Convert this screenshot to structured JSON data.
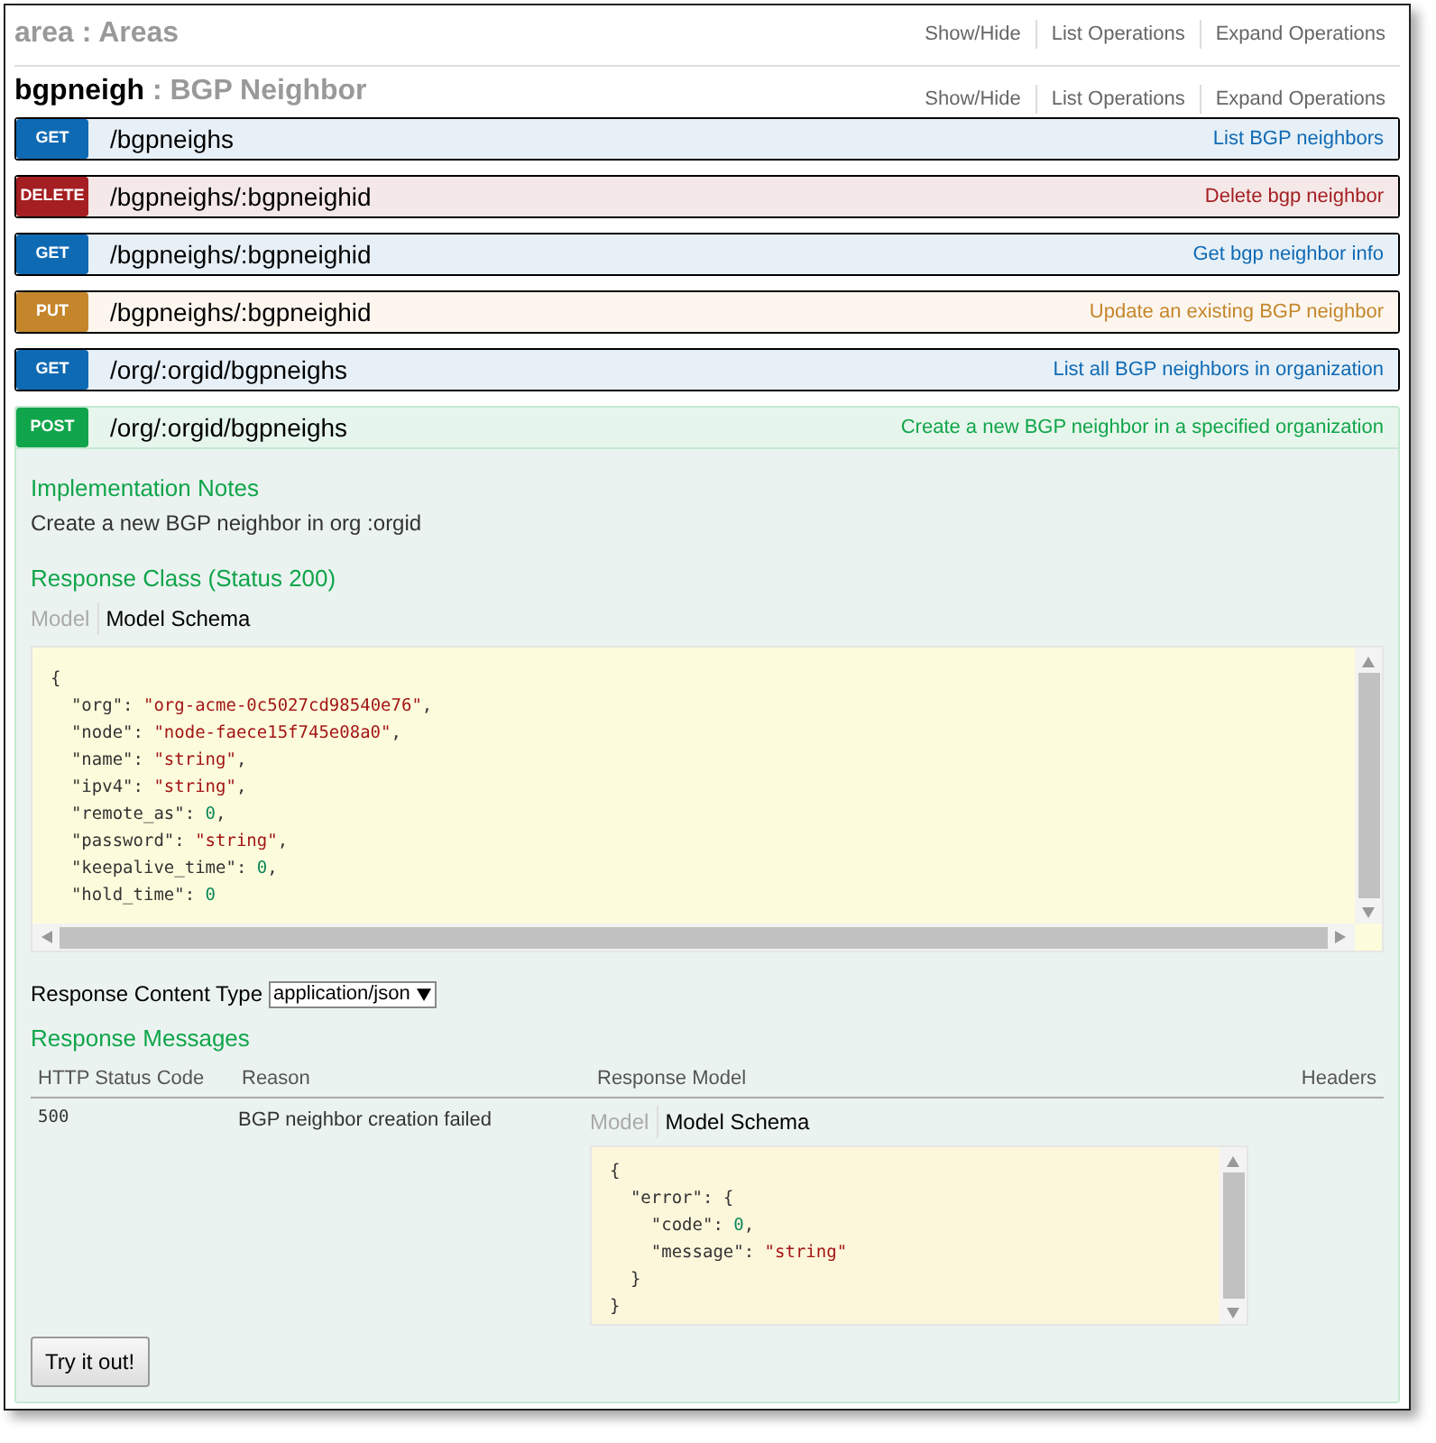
{
  "area": {
    "name": "area",
    "separator": ":",
    "title": "Areas",
    "links": [
      "Show/Hide",
      "List Operations",
      "Expand Operations"
    ]
  },
  "resource": {
    "name": "bgpneigh",
    "separator": ":",
    "title": "BGP Neighbor",
    "links": [
      "Show/Hide",
      "List Operations",
      "Expand Operations"
    ]
  },
  "operations": [
    {
      "method": "GET",
      "path": "/bgpneighs",
      "summary": "List BGP neighbors",
      "expanded": false
    },
    {
      "method": "DELETE",
      "path": "/bgpneighs/:bgpneighid",
      "summary": "Delete bgp neighbor",
      "expanded": false
    },
    {
      "method": "GET",
      "path": "/bgpneighs/:bgpneighid",
      "summary": "Get bgp neighbor info",
      "expanded": false
    },
    {
      "method": "PUT",
      "path": "/bgpneighs/:bgpneighid",
      "summary": "Update an existing BGP neighbor",
      "expanded": false
    },
    {
      "method": "GET",
      "path": "/org/:orgid/bgpneighs",
      "summary": "List all BGP neighbors in organization",
      "expanded": false
    },
    {
      "method": "POST",
      "path": "/org/:orgid/bgpneighs",
      "summary": "Create a new BGP neighbor in a specified organization",
      "expanded": true
    }
  ],
  "details": {
    "notes_heading": "Implementation Notes",
    "notes": "Create a new BGP neighbor in org :orgid",
    "response_class_heading": "Response Class (Status 200)",
    "model_tabs": [
      {
        "label": "Model",
        "selected": false
      },
      {
        "label": "Model Schema",
        "selected": true
      }
    ],
    "schema": [
      [
        {
          "t": "{",
          "kind": "plain"
        }
      ],
      [
        {
          "t": "  \"org\": ",
          "kind": "plain"
        },
        {
          "t": "\"org-acme-0c5027cd98540e76\"",
          "kind": "string"
        },
        {
          "t": ",",
          "kind": "plain"
        }
      ],
      [
        {
          "t": "  \"node\": ",
          "kind": "plain"
        },
        {
          "t": "\"node-faece15f745e08a0\"",
          "kind": "string"
        },
        {
          "t": ",",
          "kind": "plain"
        }
      ],
      [
        {
          "t": "  \"name\": ",
          "kind": "plain"
        },
        {
          "t": "\"string\"",
          "kind": "string"
        },
        {
          "t": ",",
          "kind": "plain"
        }
      ],
      [
        {
          "t": "  \"ipv4\": ",
          "kind": "plain"
        },
        {
          "t": "\"string\"",
          "kind": "string"
        },
        {
          "t": ",",
          "kind": "plain"
        }
      ],
      [
        {
          "t": "  \"remote_as\": ",
          "kind": "plain"
        },
        {
          "t": "0",
          "kind": "number"
        },
        {
          "t": ",",
          "kind": "plain"
        }
      ],
      [
        {
          "t": "  \"password\": ",
          "kind": "plain"
        },
        {
          "t": "\"string\"",
          "kind": "string"
        },
        {
          "t": ",",
          "kind": "plain"
        }
      ],
      [
        {
          "t": "  \"keepalive_time\": ",
          "kind": "plain"
        },
        {
          "t": "0",
          "kind": "number"
        },
        {
          "t": ",",
          "kind": "plain"
        }
      ],
      [
        {
          "t": "  \"hold_time\": ",
          "kind": "plain"
        },
        {
          "t": "0",
          "kind": "number"
        }
      ]
    ],
    "content_type_label": "Response Content Type",
    "content_type": "application/json",
    "messages_heading": "Response Messages",
    "columns": [
      "HTTP Status Code",
      "Reason",
      "Response Model",
      "Headers"
    ],
    "rows": [
      {
        "code": "500",
        "reason": "BGP neighbor creation failed",
        "model_tabs": [
          {
            "label": "Model",
            "selected": false
          },
          {
            "label": "Model Schema",
            "selected": true
          }
        ],
        "schema": [
          [
            {
              "t": "{",
              "kind": "plain"
            }
          ],
          [
            {
              "t": "  \"error\": {",
              "kind": "plain"
            }
          ],
          [
            {
              "t": "    \"code\": ",
              "kind": "plain"
            },
            {
              "t": "0",
              "kind": "number"
            },
            {
              "t": ",",
              "kind": "plain"
            }
          ],
          [
            {
              "t": "    \"message\": ",
              "kind": "plain"
            },
            {
              "t": "\"string\"",
              "kind": "string"
            }
          ],
          [
            {
              "t": "  }",
              "kind": "plain"
            }
          ],
          [
            {
              "t": "}",
              "kind": "plain"
            }
          ]
        ]
      }
    ],
    "try_button": "Try it out!"
  }
}
